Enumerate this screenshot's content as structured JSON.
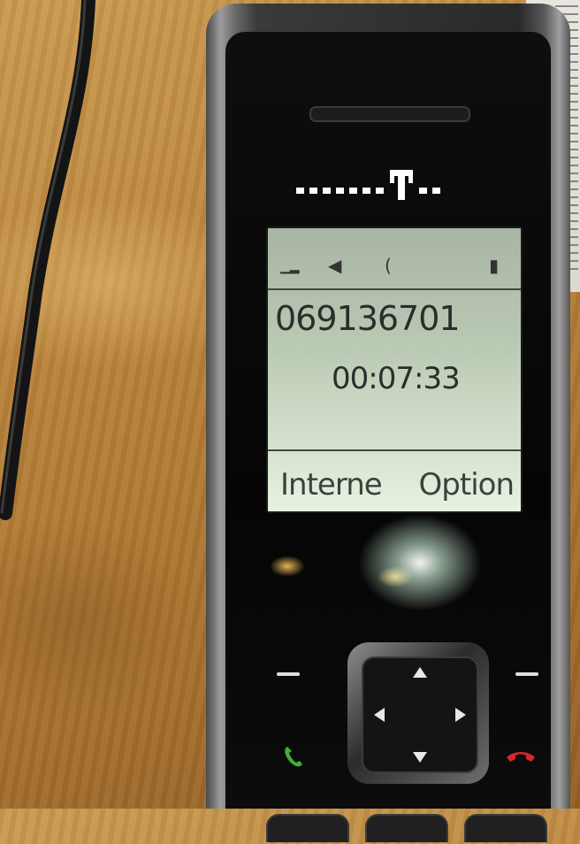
{
  "display": {
    "status_icons": [
      "signal-icon",
      "speaker-icon",
      "handset-icon",
      "battery-icon"
    ],
    "phone_number": "069136701",
    "call_timer": "00:07:33",
    "softkeys": {
      "left": "Interne",
      "right": "Option"
    }
  },
  "keys": {
    "call_icon": "green-call-icon",
    "end_icon": "red-end-call-icon",
    "nav_icons": [
      "up-arrow-icon",
      "down-arrow-icon",
      "left-arrow-icon",
      "right-arrow-icon"
    ]
  },
  "colors": {
    "lcd_background": "#c7d6c1",
    "lcd_text": "#2b332d",
    "logo_magenta": "#ffffff",
    "call_green": "#3fae3b",
    "end_red": "#d3282a"
  }
}
